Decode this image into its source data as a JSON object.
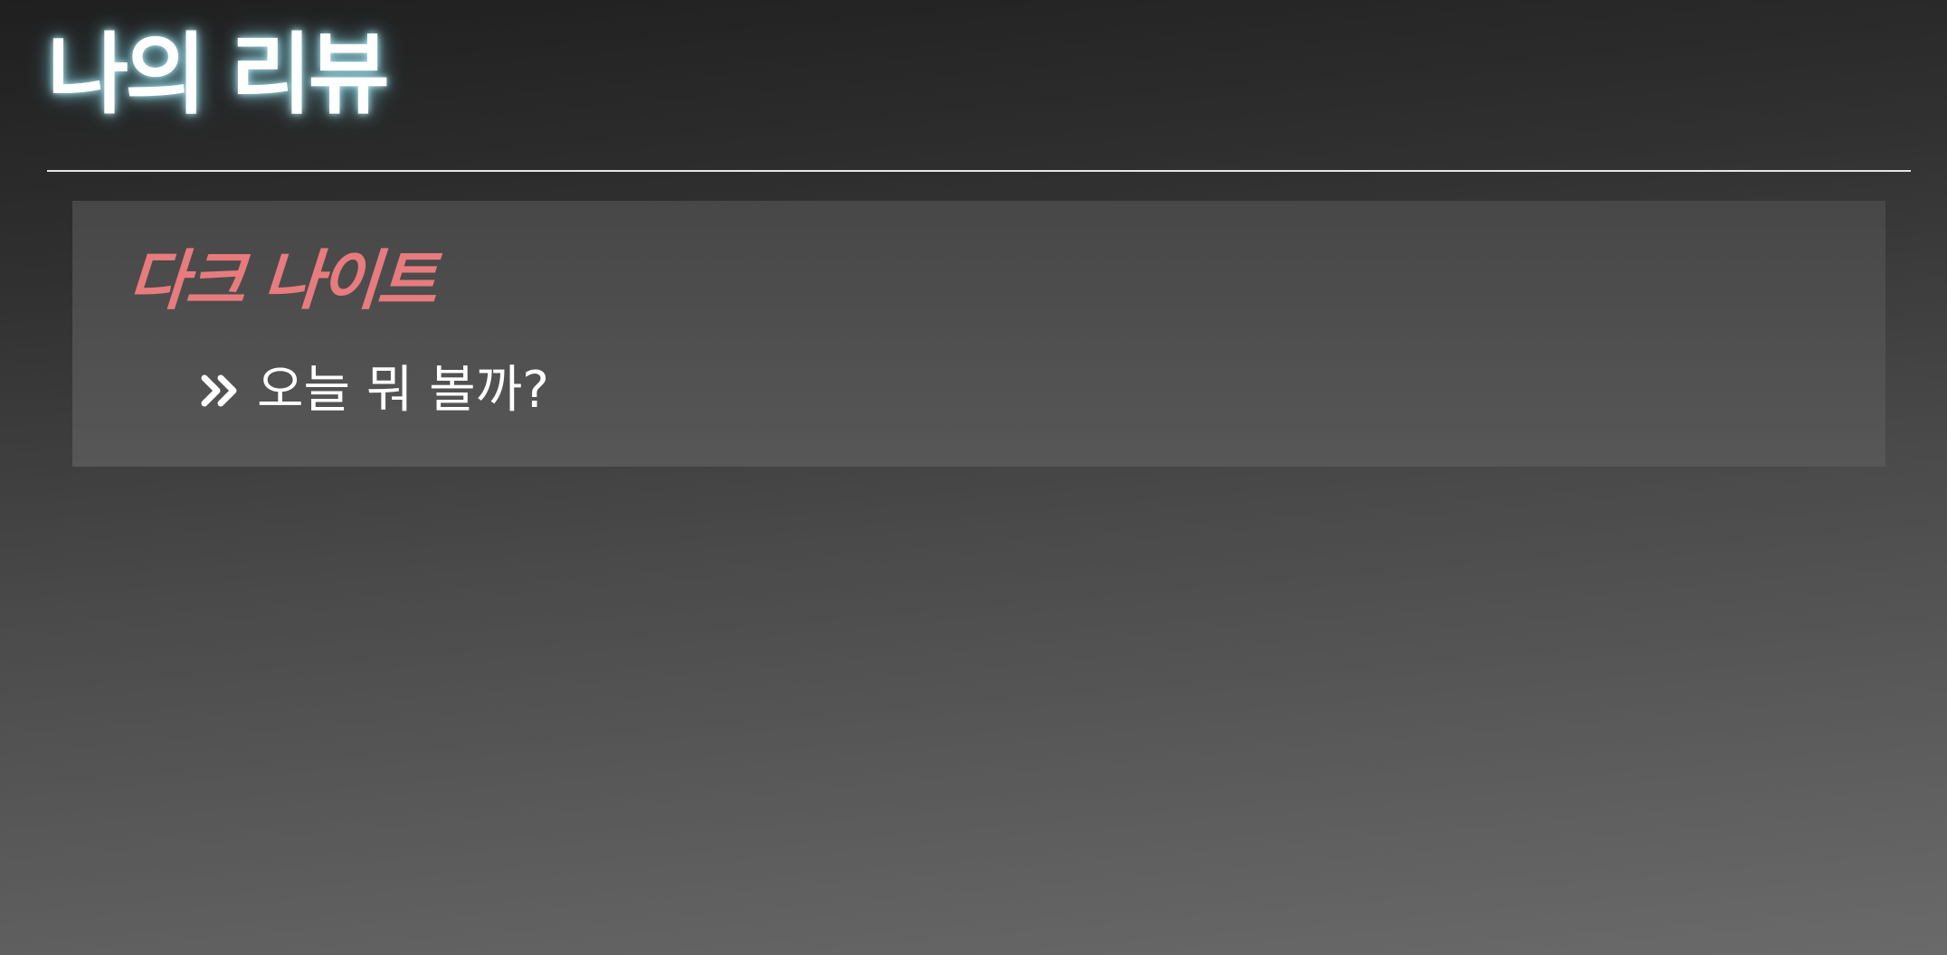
{
  "header": {
    "title": "나의 리뷰"
  },
  "reviews": [
    {
      "movie_title": "다크 나이트",
      "text": "오늘 뭐 볼까?",
      "icon": "double-chevron-right-icon"
    }
  ],
  "colors": {
    "title_glow": "#8fdcec",
    "movie_title": "#e87b7e",
    "divider": "#e6e6e6",
    "card_background": "#4f4f4f"
  }
}
